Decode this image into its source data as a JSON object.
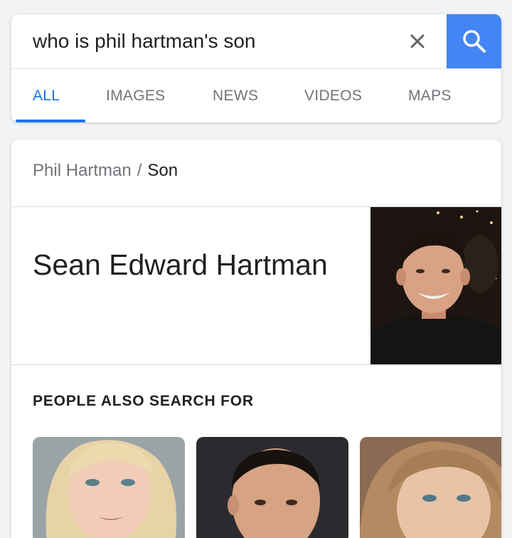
{
  "search": {
    "query": "who is phil hartman's son",
    "clear_icon": "close-icon",
    "search_icon": "search-icon",
    "accent": "#4285f4"
  },
  "tabs": [
    {
      "label": "ALL",
      "active": true
    },
    {
      "label": "IMAGES"
    },
    {
      "label": "NEWS"
    },
    {
      "label": "VIDEOS"
    },
    {
      "label": "MAPS"
    }
  ],
  "result": {
    "breadcrumb": {
      "parent": "Phil Hartman",
      "separator": "/",
      "current": "Son"
    },
    "answer": "Sean Edward Hartman",
    "people_also_search_for": {
      "heading": "PEOPLE ALSO SEARCH FOR"
    }
  }
}
